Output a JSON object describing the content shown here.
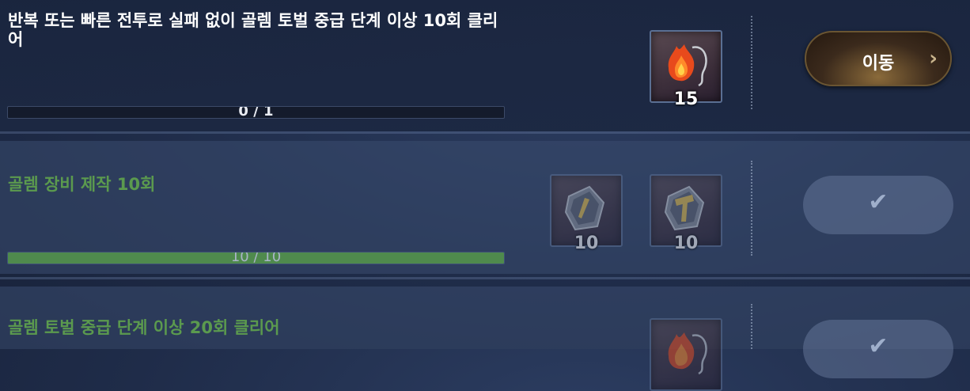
{
  "missions": [
    {
      "title": "반복 또는 빠른 전투로 실패 없이 골렘 토벌 중급 단계 이상 10회 클리어",
      "progress_text": "0 / 1",
      "progress": 0,
      "rewards": [
        {
          "icon": "fire-necklace-icon",
          "quantity": "15"
        }
      ],
      "action_label": "이동",
      "action_arrow": "›"
    },
    {
      "title": "골렘 장비 제작 10회",
      "progress_text": "10 / 10",
      "progress": 1,
      "rewards": [
        {
          "icon": "weapon-stone-icon",
          "quantity": "10"
        },
        {
          "icon": "hammer-stone-icon",
          "quantity": "10"
        }
      ],
      "action_label": "✔"
    },
    {
      "title": "골렘 토벌 중급 단계 이상 20회 클리어",
      "rewards": [
        {
          "icon": "fire-necklace-icon"
        }
      ],
      "action_label": "✔"
    }
  ],
  "colors": {
    "completed_text": "#5b9a4e",
    "progress_fill": "#4f8a4d",
    "move_button": "#3b2a1c"
  }
}
